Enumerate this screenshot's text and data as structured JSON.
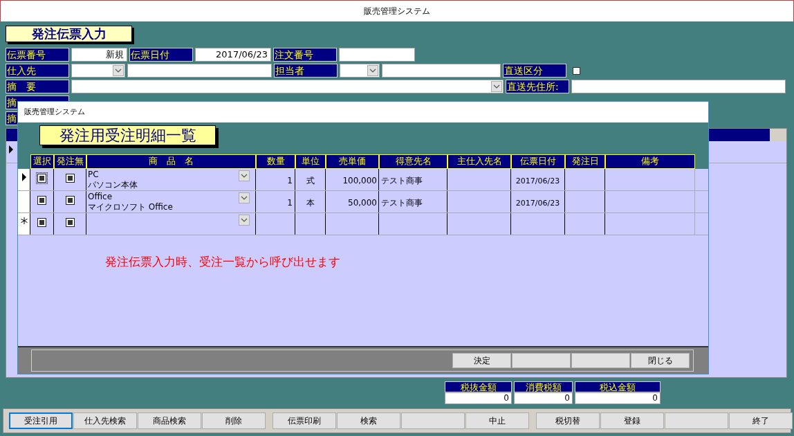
{
  "window": {
    "title": "販売管理システム"
  },
  "form": {
    "title": "発注伝票入力",
    "row1": [
      {
        "kind": "label",
        "text": "伝票番号"
      },
      {
        "kind": "field",
        "value": "新規"
      },
      {
        "kind": "label",
        "text": "伝票日付"
      },
      {
        "kind": "field",
        "value": "2017/06/23"
      },
      {
        "kind": "label",
        "text": "注文番号"
      },
      {
        "kind": "field"
      }
    ],
    "row2": [
      {
        "kind": "label",
        "text": "仕入先"
      },
      {
        "kind": "combo"
      },
      {
        "kind": "field"
      },
      {
        "kind": "label",
        "text": "担当者"
      },
      {
        "kind": "combo"
      },
      {
        "kind": "field"
      },
      {
        "kind": "label",
        "text": "直送区分"
      },
      {
        "kind": "checkbox",
        "checked": false
      }
    ],
    "row3": [
      {
        "kind": "label",
        "text": "摘　要"
      },
      {
        "kind": "combo"
      },
      {
        "kind": "label",
        "text": "直送先住所:"
      },
      {
        "kind": "field"
      }
    ],
    "row4": [
      {
        "kind": "label",
        "text": "摘"
      }
    ],
    "row5": [
      {
        "kind": "label",
        "text": "摘"
      }
    ],
    "grid_rows": [
      {
        "kind": "current"
      }
    ],
    "totals": [
      {
        "label": "税抜金額",
        "value": "0"
      },
      {
        "label": "消費税額",
        "value": "0"
      },
      {
        "label": "税込金額",
        "value": "0"
      }
    ],
    "buttons": [
      {
        "label": "受注引用",
        "focused": true
      },
      {
        "label": "仕入先検索",
        "focused": false
      },
      {
        "label": "商品検索",
        "focused": false
      },
      {
        "label": "削除",
        "focused": false
      },
      {
        "label": "伝票印刷",
        "focused": false
      },
      {
        "label": "検索",
        "focused": false
      },
      {
        "focused": false
      },
      {
        "label": "中止",
        "focused": false
      },
      {
        "label": "税切替",
        "focused": false
      },
      {
        "label": "登録",
        "focused": false
      },
      {
        "focused": false
      },
      {
        "label": "終了",
        "focused": false
      }
    ]
  },
  "dialog": {
    "title": "販売管理システム",
    "heading": "発注用受注明細一覧",
    "columns": [
      "選択",
      "発注無",
      "商　品　名",
      "数量",
      "単位",
      "売単価",
      "得意先名",
      "主仕入先名",
      "伝票日付",
      "発注日",
      "備考"
    ],
    "rows": [
      {
        "kind": "current",
        "select": {
          "indeterminate": true,
          "focused": true
        },
        "no_order": {
          "indeterminate": true,
          "focused": false
        },
        "code": "PC",
        "product": "パソコン本体",
        "qty": "1",
        "unit": "式",
        "price": "100,000",
        "customer": "テスト商事",
        "date": "2017/06/23"
      },
      {
        "kind": "normal",
        "select": {
          "indeterminate": true,
          "focused": false
        },
        "no_order": {
          "indeterminate": true,
          "focused": false
        },
        "code": "Office",
        "product": "マイクロソフト Office",
        "qty": "1",
        "unit": "本",
        "price": "50,000",
        "customer": "テスト商事",
        "date": "2017/06/23"
      },
      {
        "kind": "new",
        "select": {
          "indeterminate": true,
          "focused": false
        },
        "no_order": {
          "indeterminate": true,
          "focused": false
        }
      }
    ],
    "message": "発注伝票入力時、受注一覧から呼び出せます",
    "buttons": [
      {
        "kind": "labelled",
        "label": "決定"
      },
      {
        "kind": "blank"
      },
      {
        "kind": "blank"
      },
      {
        "kind": "labelled",
        "label": "閉じる"
      }
    ]
  }
}
